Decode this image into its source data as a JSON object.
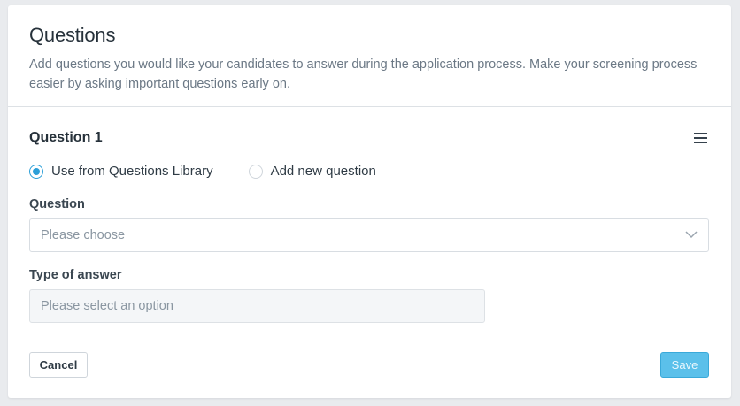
{
  "header": {
    "title": "Questions",
    "description": "Add questions you would like your candidates to answer during the application process. Make your screening process easier by asking important questions early on."
  },
  "question": {
    "title": "Question 1",
    "menu_icon": "hamburger-menu-icon",
    "options": [
      {
        "label": "Use from Questions Library",
        "checked": true
      },
      {
        "label": "Add new question",
        "checked": false
      }
    ],
    "question_field": {
      "label": "Question",
      "placeholder": "Please choose"
    },
    "answer_type_field": {
      "label": "Type of answer",
      "placeholder": "Please select an option"
    }
  },
  "actions": {
    "cancel_label": "Cancel",
    "save_label": "Save"
  },
  "colors": {
    "accent": "#2b9fd8",
    "save_button": "#5bc0ea"
  }
}
